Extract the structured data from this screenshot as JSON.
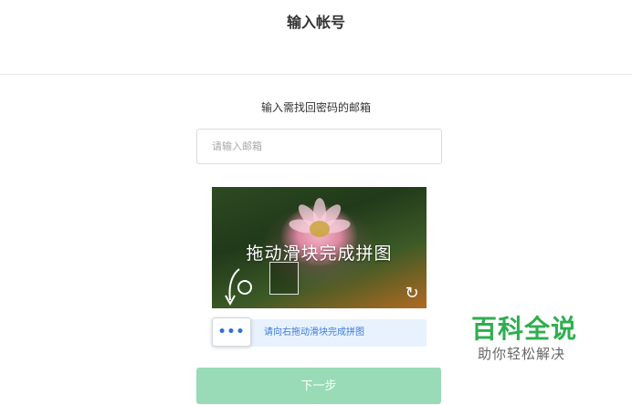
{
  "header": {
    "title": "输入帐号"
  },
  "form": {
    "instruction": "输入需找回密码的邮箱",
    "email_placeholder": "请输入邮箱",
    "email_value": ""
  },
  "captcha": {
    "overlay_text": "拖动滑块完成拼图",
    "slider_hint": "请向右拖动滑块完成拼图",
    "handle_glyph": "•••",
    "refresh_glyph": "↻"
  },
  "actions": {
    "next_label": "下一步"
  },
  "watermark": {
    "brand": "百科全说",
    "slogan": "助你轻松解决"
  },
  "colors": {
    "primary_button": "#98dbb6",
    "slider_track": "#e8f2fe",
    "slider_text": "#3d7bd9",
    "watermark_green": "#2fae4f"
  }
}
